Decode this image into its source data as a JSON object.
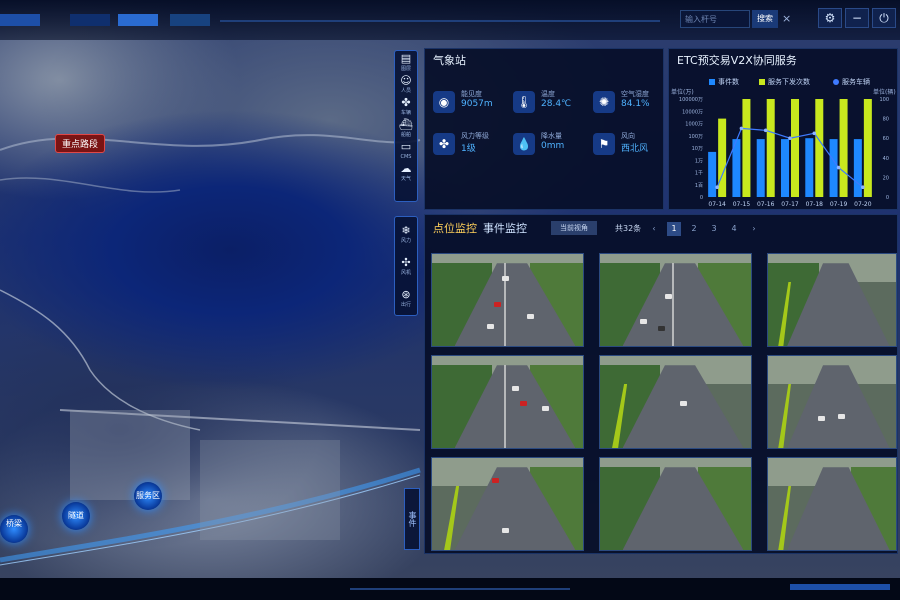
{
  "topbar": {
    "search_placeholder": "输入杆号",
    "search_button": "搜索",
    "close_glyph": "×",
    "settings_icon": "gear-icon",
    "minimize_icon": "minus-icon",
    "power_icon": "power-icon"
  },
  "map": {
    "marker_label": "重点路段",
    "nodes": [
      "隧道",
      "服务区"
    ],
    "partial_node": "桥梁"
  },
  "tools_top": [
    {
      "icon": "list-icon",
      "label": "图层"
    },
    {
      "icon": "person-icon",
      "label": "人员"
    },
    {
      "icon": "vehicle-icon",
      "label": "车辆"
    },
    {
      "icon": "ship-icon",
      "label": "船舶"
    },
    {
      "icon": "cms-icon",
      "label": "CMS"
    },
    {
      "icon": "weather-icon",
      "label": "天气"
    }
  ],
  "tools_bottom": [
    {
      "icon": "wind-icon",
      "label": "风力"
    },
    {
      "icon": "fan-icon",
      "label": "风机"
    },
    {
      "icon": "steer-icon",
      "label": "出行"
    }
  ],
  "side_tab": "事件",
  "weather": {
    "title": "气象站",
    "items": [
      {
        "icon": "eye-icon",
        "label": "能见度",
        "value": "9057m"
      },
      {
        "icon": "thermometer-icon",
        "label": "温度",
        "value": "28.4℃"
      },
      {
        "icon": "humidity-icon",
        "label": "空气湿度",
        "value": "84.1%"
      },
      {
        "icon": "wind-icon",
        "label": "风力等级",
        "value": "1级"
      },
      {
        "icon": "rain-icon",
        "label": "降水量",
        "value": "0mm"
      },
      {
        "icon": "flag-icon",
        "label": "风向",
        "value": "西北风"
      }
    ]
  },
  "etc": {
    "title": "ETC预交易V2X协同服务",
    "colors": {
      "events": "#1e88ff",
      "dispatch": "#c8e81e",
      "vehicles": "#3f7bff"
    }
  },
  "chart_data": {
    "type": "bar",
    "title": "ETC预交易V2X协同服务",
    "categories": [
      "07-14",
      "07-15",
      "07-16",
      "07-17",
      "07-18",
      "07-19",
      "07-20"
    ],
    "series": [
      {
        "name": "事件数",
        "type": "bar",
        "axis": "left",
        "values": [
          200,
          900,
          900,
          900,
          1000,
          900,
          900
        ]
      },
      {
        "name": "服务下发次数",
        "type": "bar",
        "axis": "left",
        "values": [
          10000,
          100000,
          100000,
          100000,
          100000,
          100000,
          100000
        ]
      },
      {
        "name": "服务车辆",
        "type": "line",
        "axis": "right",
        "values": [
          10,
          70,
          68,
          60,
          65,
          30,
          10
        ]
      }
    ],
    "y_left": {
      "label": "单位(万)",
      "scale": "log",
      "ticks": [
        "100000万",
        "10000万",
        "1000万",
        "100万",
        "10万",
        "1万",
        "1千",
        "1百",
        "0"
      ]
    },
    "y_right": {
      "label": "单位(辆)",
      "ylim": [
        0,
        100
      ],
      "ticks": [
        "100",
        "80",
        "60",
        "40",
        "20",
        "0"
      ]
    },
    "legend": "top"
  },
  "monitor": {
    "tab_active": "点位监控",
    "tab_other": "事件监控",
    "view_button": "当前视角",
    "count": "共32条",
    "pager": [
      "‹",
      "1",
      "2",
      "3",
      "4",
      "›"
    ]
  }
}
